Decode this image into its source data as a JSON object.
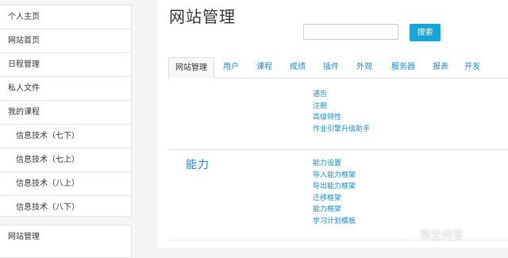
{
  "sidebar": {
    "group1": [
      {
        "label": "个人主页"
      },
      {
        "label": "网站首页"
      },
      {
        "label": "日程管理"
      },
      {
        "label": "私人文件"
      },
      {
        "label": "我的课程"
      },
      {
        "label": "信息技术（七下）"
      },
      {
        "label": "信息技术（七上）"
      },
      {
        "label": "信息技术（八上）"
      },
      {
        "label": "信息技术（八下）"
      }
    ],
    "group2": [
      {
        "label": "网站管理"
      }
    ]
  },
  "header": {
    "title": "网站管理",
    "search_placeholder": "",
    "search_label": "搜索"
  },
  "tabs": [
    {
      "label": "网站管理"
    },
    {
      "label": "用户"
    },
    {
      "label": "课程"
    },
    {
      "label": "成绩"
    },
    {
      "label": "插件"
    },
    {
      "label": "外观"
    },
    {
      "label": "服务器"
    },
    {
      "label": "报表"
    },
    {
      "label": "开发"
    }
  ],
  "section1": {
    "links": [
      "通告",
      "注册",
      "高级特性",
      "作业引擎升级助手"
    ]
  },
  "section2": {
    "heading": "能力",
    "links": [
      "能力设置",
      "导入能力框架",
      "导出能力框架",
      "迁移框架",
      "能力框架",
      "学习计划模板"
    ]
  },
  "watermark": {
    "text": "悟空问答"
  },
  "colors": {
    "accent": "#1aa3d8",
    "link": "#1a8cc8"
  }
}
